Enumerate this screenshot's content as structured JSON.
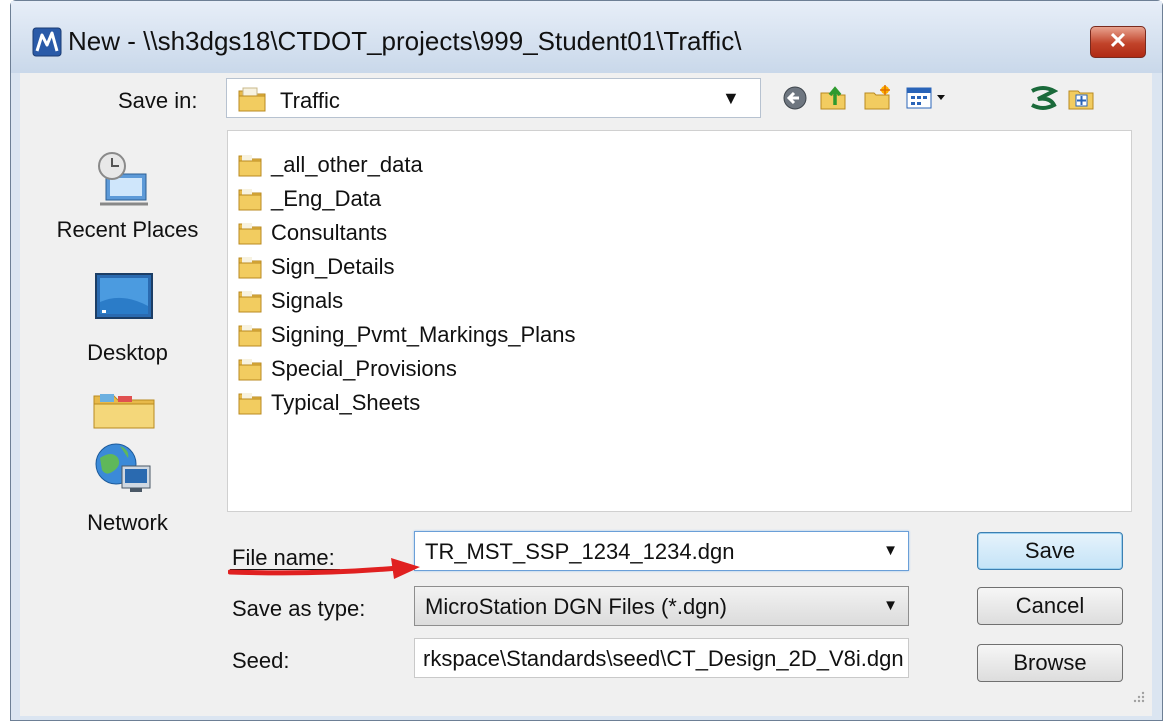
{
  "window": {
    "title": "New - \\\\sh3dgs18\\CTDOT_projects\\999_Student01\\Traffic\\",
    "close_label": "✕",
    "accent": "#c1432a"
  },
  "save_in": {
    "label": "Save in:",
    "value": "Traffic"
  },
  "toolbar": {
    "icons": [
      "back-icon",
      "up-folder-icon",
      "new-folder-icon",
      "view-menu-icon",
      "projectwise-icon",
      "properties-icon"
    ]
  },
  "places": [
    {
      "label": "Recent Places",
      "icon": "recent-places-icon"
    },
    {
      "label": "Desktop",
      "icon": "desktop-icon"
    },
    {
      "label": "",
      "icon": "libraries-folder-icon"
    },
    {
      "label": "Network",
      "icon": "network-icon"
    }
  ],
  "folders": [
    "_all_other_data",
    "_Eng_Data",
    "Consultants",
    "Sign_Details",
    "Signals",
    "Signing_Pvmt_Markings_Plans",
    "Special_Provisions",
    "Typical_Sheets"
  ],
  "form": {
    "file_name_label": "File name:",
    "file_name_value": "TR_MST_SSP_1234_1234.dgn",
    "save_as_type_label": "Save as type:",
    "save_as_type_value": "MicroStation DGN Files (*.dgn)",
    "seed_label": "Seed:",
    "seed_value": "rkspace\\Standards\\seed\\CT_Design_2D_V8i.dgn"
  },
  "buttons": {
    "save": "Save",
    "cancel": "Cancel",
    "browse": "Browse"
  },
  "annotation": {
    "arrow_color": "#e02020"
  }
}
